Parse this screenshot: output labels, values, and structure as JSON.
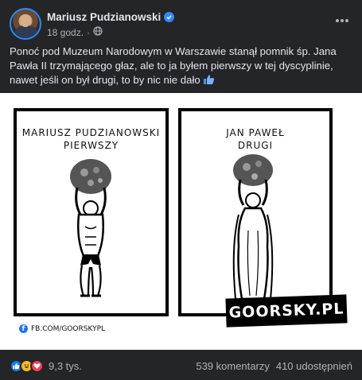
{
  "post": {
    "author": "Mariusz Pudzianowski",
    "time": "18 godz.",
    "text": "Ponoć pod Muzeum Narodowym w Warszawie stanął pomnik śp. Jana Pawła II trzymającego głaz, ale to ja byłem pierwszy w tej dyscyplinie, nawet jeśli on był drugi, to by nic nie dało"
  },
  "image": {
    "left_title_line1": "MARIUSZ PUDZIANOWSKI",
    "left_title_line2": "PIERWSZY",
    "right_title_line1": "JAN PAWEŁ",
    "right_title_line2": "DRUGI",
    "fb_handle": "FB.COM/GOORSKYPL",
    "watermark": "GOORSKY.PL"
  },
  "footer": {
    "reaction_count": "9,3 tys.",
    "comments": "539 komentarzy",
    "shares": "410 udostępnień"
  },
  "icons": {
    "verified": "verified-badge-icon",
    "audience": "globe-icon",
    "more": "more-options-icon",
    "reactions": [
      "like-icon",
      "haha-icon",
      "love-icon"
    ]
  },
  "colors": {
    "background": "#242526",
    "accent": "#2d88ff",
    "text_primary": "#e4e6eb",
    "text_secondary": "#b0b3b8"
  }
}
